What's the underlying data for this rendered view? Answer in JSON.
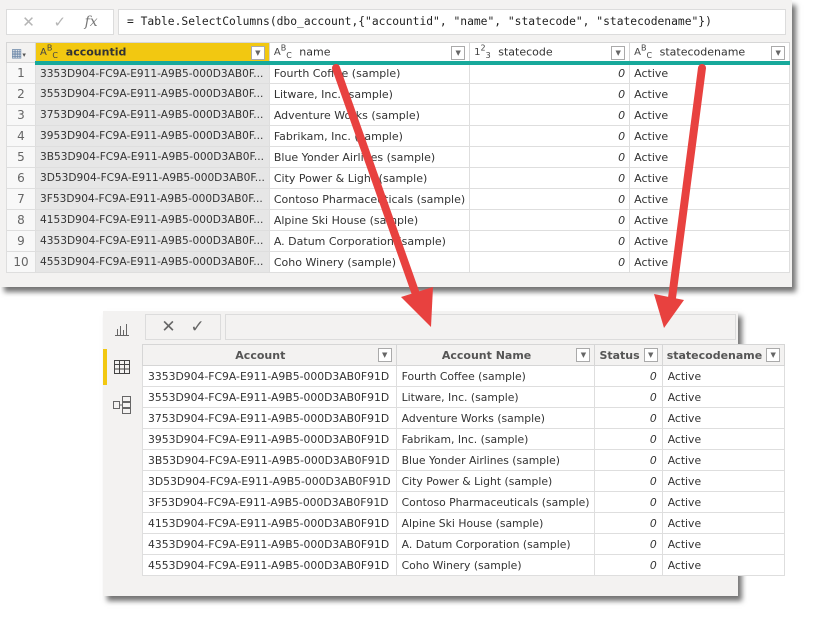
{
  "power_query": {
    "formula_bar": {
      "cancel_icon": "✕",
      "commit_icon": "✓",
      "fx_label": "fx",
      "formula": "= Table.SelectColumns(dbo_account,{\"accountid\", \"name\", \"statecode\", \"statecodename\"})"
    },
    "table_menu_icon": "▦",
    "columns": [
      {
        "type_icon": "ABC",
        "label": "accountid",
        "selected": true
      },
      {
        "type_icon": "ABC",
        "label": "name"
      },
      {
        "type_icon": "123",
        "label": "statecode"
      },
      {
        "type_icon": "ABC",
        "label": "statecodename"
      }
    ],
    "rows": [
      {
        "num": "1",
        "accountid": "3353D904-FC9A-E911-A9B5-000D3AB0F...",
        "name": "Fourth Coffee (sample)",
        "statecode": "0",
        "statecodename": "Active"
      },
      {
        "num": "2",
        "accountid": "3553D904-FC9A-E911-A9B5-000D3AB0F...",
        "name": "Litware, Inc. (sample)",
        "statecode": "0",
        "statecodename": "Active"
      },
      {
        "num": "3",
        "accountid": "3753D904-FC9A-E911-A9B5-000D3AB0F...",
        "name": "Adventure Works (sample)",
        "statecode": "0",
        "statecodename": "Active"
      },
      {
        "num": "4",
        "accountid": "3953D904-FC9A-E911-A9B5-000D3AB0F...",
        "name": "Fabrikam, Inc. (sample)",
        "statecode": "0",
        "statecodename": "Active"
      },
      {
        "num": "5",
        "accountid": "3B53D904-FC9A-E911-A9B5-000D3AB0F...",
        "name": "Blue Yonder Airlines (sample)",
        "statecode": "0",
        "statecodename": "Active"
      },
      {
        "num": "6",
        "accountid": "3D53D904-FC9A-E911-A9B5-000D3AB0F...",
        "name": "City Power & Light (sample)",
        "statecode": "0",
        "statecodename": "Active"
      },
      {
        "num": "7",
        "accountid": "3F53D904-FC9A-E911-A9B5-000D3AB0F...",
        "name": "Contoso Pharmaceuticals (sample)",
        "statecode": "0",
        "statecodename": "Active"
      },
      {
        "num": "8",
        "accountid": "4153D904-FC9A-E911-A9B5-000D3AB0F...",
        "name": "Alpine Ski House (sample)",
        "statecode": "0",
        "statecodename": "Active"
      },
      {
        "num": "9",
        "accountid": "4353D904-FC9A-E911-A9B5-000D3AB0F...",
        "name": "A. Datum Corporation (sample)",
        "statecode": "0",
        "statecodename": "Active"
      },
      {
        "num": "10",
        "accountid": "4553D904-FC9A-E911-A9B5-000D3AB0F...",
        "name": "Coho Winery (sample)",
        "statecode": "0",
        "statecodename": "Active"
      }
    ]
  },
  "power_bi": {
    "rail": {
      "report_icon": "report-view",
      "data_icon": "data-view",
      "model_icon": "model-view"
    },
    "toolbar": {
      "cancel_icon": "✕",
      "commit_icon": "✓"
    },
    "columns": [
      {
        "label": "Account"
      },
      {
        "label": "Account Name"
      },
      {
        "label": "Status"
      },
      {
        "label": "statecodename"
      }
    ],
    "rows": [
      {
        "account": "3353D904-FC9A-E911-A9B5-000D3AB0F91D",
        "name": "Fourth Coffee (sample)",
        "status": "0",
        "statecodename": "Active"
      },
      {
        "account": "3553D904-FC9A-E911-A9B5-000D3AB0F91D",
        "name": "Litware, Inc. (sample)",
        "status": "0",
        "statecodename": "Active"
      },
      {
        "account": "3753D904-FC9A-E911-A9B5-000D3AB0F91D",
        "name": "Adventure Works (sample)",
        "status": "0",
        "statecodename": "Active"
      },
      {
        "account": "3953D904-FC9A-E911-A9B5-000D3AB0F91D",
        "name": "Fabrikam, Inc. (sample)",
        "status": "0",
        "statecodename": "Active"
      },
      {
        "account": "3B53D904-FC9A-E911-A9B5-000D3AB0F91D",
        "name": "Blue Yonder Airlines (sample)",
        "status": "0",
        "statecodename": "Active"
      },
      {
        "account": "3D53D904-FC9A-E911-A9B5-000D3AB0F91D",
        "name": "City Power & Light (sample)",
        "status": "0",
        "statecodename": "Active"
      },
      {
        "account": "3F53D904-FC9A-E911-A9B5-000D3AB0F91D",
        "name": "Contoso Pharmaceuticals (sample)",
        "status": "0",
        "statecodename": "Active"
      },
      {
        "account": "4153D904-FC9A-E911-A9B5-000D3AB0F91D",
        "name": "Alpine Ski House (sample)",
        "status": "0",
        "statecodename": "Active"
      },
      {
        "account": "4353D904-FC9A-E911-A9B5-000D3AB0F91D",
        "name": "A. Datum Corporation (sample)",
        "status": "0",
        "statecodename": "Active"
      },
      {
        "account": "4553D904-FC9A-E911-A9B5-000D3AB0F91D",
        "name": "Coho Winery (sample)",
        "status": "0",
        "statecodename": "Active"
      }
    ]
  },
  "colors": {
    "selected_column": "#f2c811",
    "quality_bar": "#17a99b",
    "arrow": "#e8413f",
    "active_rail": "#f2c811"
  }
}
